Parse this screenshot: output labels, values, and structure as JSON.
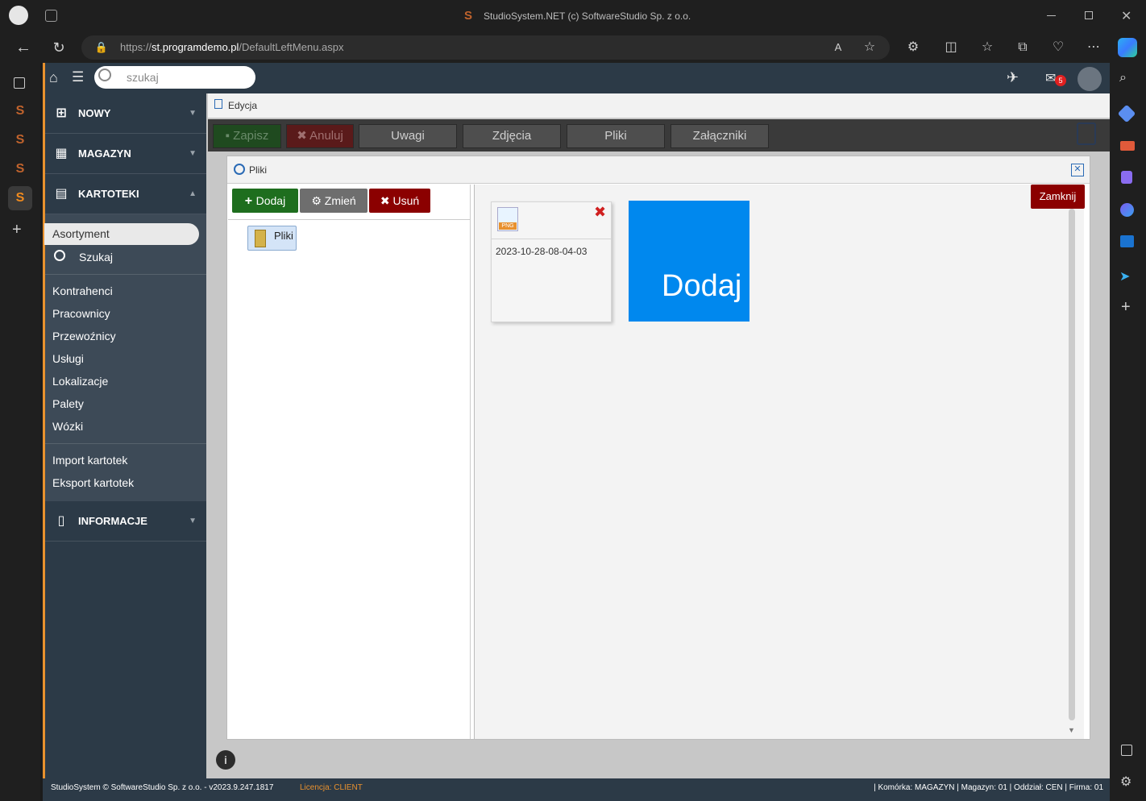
{
  "browser": {
    "title": "StudioSystem.NET (c) SoftwareStudio Sp. z o.o.",
    "url_prefix": "https://",
    "url_host": "st.programdemo.pl",
    "url_path": "/DefaultLeftMenu.aspx",
    "mail_badge": "5"
  },
  "app": {
    "search_placeholder": "szukaj",
    "sidebar": {
      "nowy": "NOWY",
      "magazyn": "MAGAZYN",
      "kartoteki": "KARTOTEKI",
      "informacje": "INFORMACJE",
      "items_top": [
        "Asortyment",
        "Szukaj"
      ],
      "items_mid": [
        "Kontrahenci",
        "Pracownicy",
        "Przewoźnicy",
        "Usługi",
        "Lokalizacje",
        "Palety",
        "Wózki"
      ],
      "items_bottom": [
        "Import kartotek",
        "Eksport kartotek"
      ]
    },
    "tab_label": "Edycja",
    "toolbar": [
      "Zapisz",
      "Anuluj",
      "Uwagi",
      "Zdjęcia",
      "Pliki",
      "Załączniki"
    ],
    "modal": {
      "title": "Pliki",
      "add": "Dodaj",
      "change": "Zmień",
      "delete": "Usuń",
      "folder": "Pliki",
      "close": "Zamknij",
      "file_name": "2023-10-28-08-04-03",
      "file_type": "PNG",
      "add_tile": "Dodaj"
    },
    "footer": {
      "copyright": "StudioSystem © SoftwareStudio Sp. z o.o. - v2023.9.247.1817",
      "license": "Licencja: CLIENT",
      "status": "| Komórka: MAGAZYN | Magazyn: 01 | Oddział: CEN | Firma: 01"
    }
  }
}
